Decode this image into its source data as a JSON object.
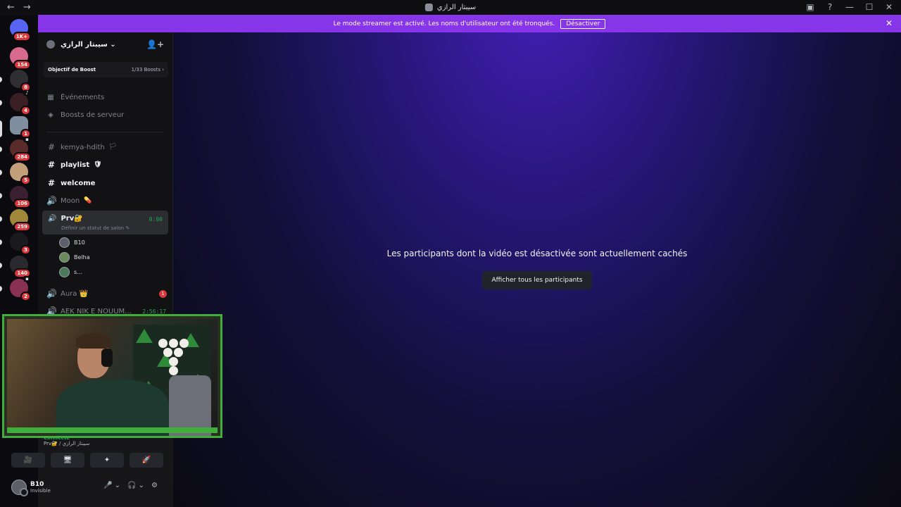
{
  "window": {
    "title": "سيبتار الرازي",
    "nav_back": "←",
    "nav_forward": "→",
    "controls": [
      "▣",
      "?",
      "—",
      "☐",
      "✕"
    ]
  },
  "servers": [
    {
      "badge": "1K+",
      "color": "#5865f2"
    },
    {
      "badge": "154",
      "color": "#d86a8e"
    },
    {
      "badge": "8",
      "color": "#2e2e33"
    },
    {
      "badge": "4",
      "color": "#3a1f24"
    },
    {
      "badge": "1",
      "color": "#7f8fa0"
    },
    {
      "badge": "284",
      "color": "#5a2b2b"
    },
    {
      "badge": "5",
      "color": "#c4a07a"
    },
    {
      "badge": "106",
      "color": "#3a2030"
    },
    {
      "badge": "259",
      "color": "#a0873a"
    },
    {
      "badge": "3",
      "color": "#1a1a1e"
    },
    {
      "badge": "140",
      "color": "#2a2a2e"
    },
    {
      "badge": "2",
      "color": "#8a3050"
    }
  ],
  "banner": {
    "text": "Le mode streamer est activé. Les noms d'utilisateur ont été tronqués.",
    "button": "Désactiver",
    "close": "✕"
  },
  "guild": {
    "name": "سيبتار الرازي ⌄",
    "add_icon": "👤+",
    "boost_label": "Objectif de Boost",
    "boost_value": "1/33 Boosts ›"
  },
  "menu": {
    "events": "Événements",
    "boosts": "Boosts de serveur"
  },
  "channels": [
    {
      "name": "kemya-hdith",
      "emoji": "🏳",
      "glyph": "#",
      "active": false
    },
    {
      "name": "playlist",
      "emoji": "🛡",
      "glyph": "#",
      "active": true
    },
    {
      "name": "welcome",
      "emoji": "",
      "glyph": "#",
      "active": true
    },
    {
      "name": "Moon",
      "emoji": "💊",
      "glyph": "🔊",
      "active": false
    }
  ],
  "voice": {
    "name": "Prv🔐",
    "time": "0:00",
    "status": "Définir un statut de salon ✎",
    "members": [
      "B10",
      "Belha",
      "s..."
    ]
  },
  "more_channels": [
    {
      "name": "Aura 👑",
      "unread": "1"
    },
    {
      "name": "AEK NIK E NOUUM...",
      "time": "2:56:17"
    }
  ],
  "connection": {
    "state": "Connecté",
    "location": "Prv🔐 / سيبتار الرازي"
  },
  "actions": [
    "🎥",
    "🖥",
    "✦",
    "🚀"
  ],
  "user": {
    "name": "B10",
    "status": "Invisible",
    "controls": [
      "🎤 ⌄",
      "🎧 ⌄",
      "⚙"
    ]
  },
  "stage": {
    "message": "Les participants dont la vidéo est désactivée sont actuellement cachés",
    "button": "Afficher tous les participants"
  }
}
